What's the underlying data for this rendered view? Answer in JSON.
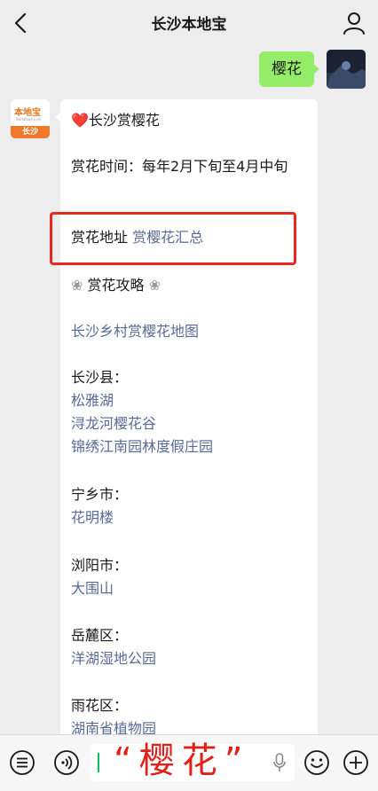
{
  "header": {
    "title": "长沙本地宝",
    "back_icon": "chevron-left-icon",
    "user_icon": "person-icon"
  },
  "chat": {
    "outgoing": {
      "text": "樱花"
    },
    "bot_avatar": {
      "brand": "本地宝",
      "sub": "Bendibao.com",
      "city": "长沙"
    },
    "incoming": {
      "title": "长沙赏樱花",
      "time_line": "赏花时间：每年2月下旬至4月中旬",
      "addr_label": "赏花地址",
      "addr_link": "赏樱花汇总",
      "guide_heading": "赏花攻略",
      "map_link": "长沙乡村赏樱花地图",
      "sections": [
        {
          "label": "长沙县：",
          "links": [
            "松雅湖",
            "浔龙河樱花谷",
            "锦绣江南园林度假庄园"
          ]
        },
        {
          "label": "宁乡市：",
          "links": [
            "花明楼"
          ]
        },
        {
          "label": "浏阳市：",
          "links": [
            "大围山"
          ]
        },
        {
          "label": "岳麓区：",
          "links": [
            "洋湖湿地公园"
          ]
        },
        {
          "label": "雨花区：",
          "links": [
            "湖南省植物园"
          ]
        }
      ]
    }
  },
  "overlay": {
    "text": "“樱花”"
  },
  "colors": {
    "bubble_out": "#95ec69",
    "link": "#576b95",
    "highlight_box": "#e8281f",
    "overlay_text": "#e0211a"
  }
}
